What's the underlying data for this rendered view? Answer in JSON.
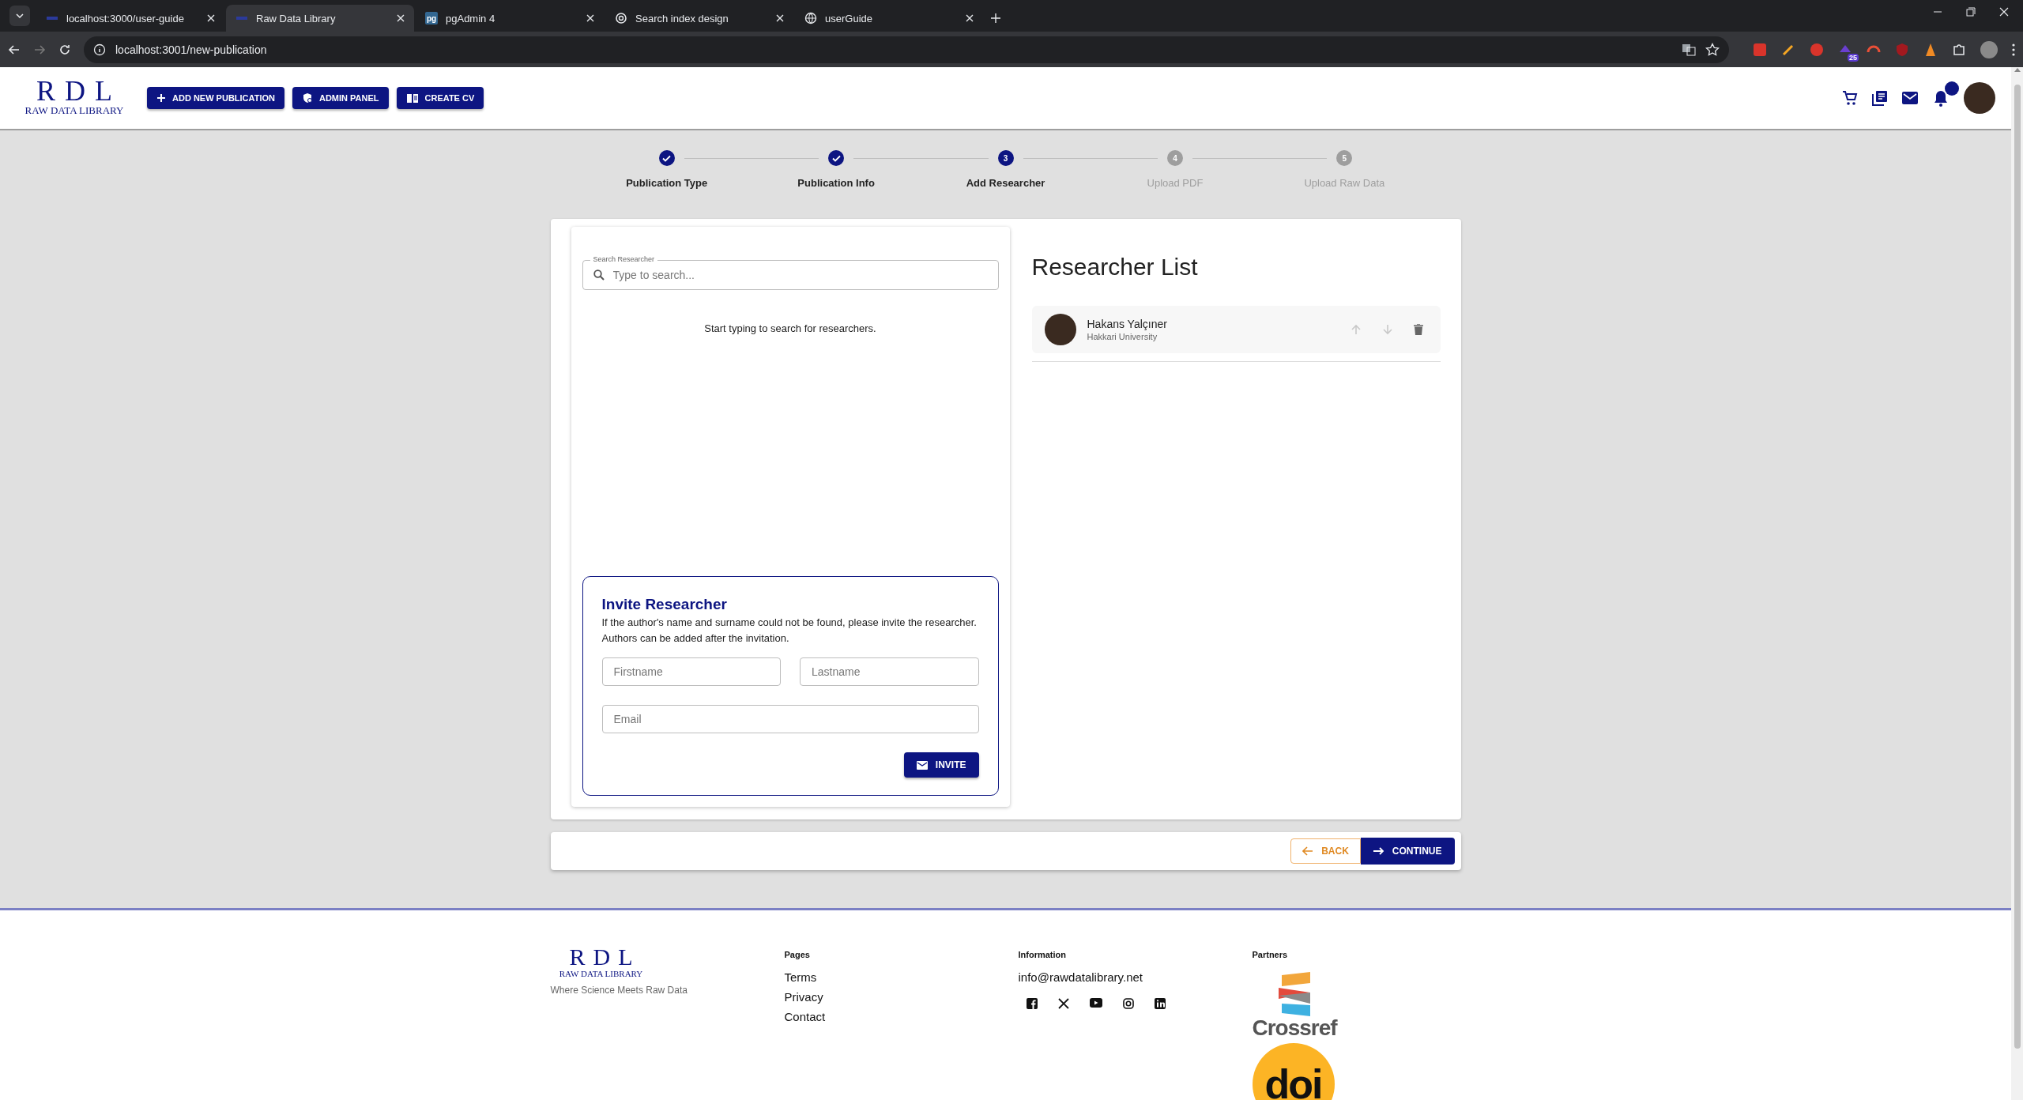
{
  "browser": {
    "tabs": [
      {
        "title": "localhost:3000/user-guide",
        "kind": "rdl",
        "selected": false
      },
      {
        "title": "Raw Data Library",
        "kind": "rdl",
        "selected": true
      },
      {
        "title": "pgAdmin 4",
        "kind": "pg",
        "selected": false
      },
      {
        "title": "Search index design",
        "kind": "knot",
        "selected": false
      },
      {
        "title": "userGuide",
        "kind": "globe",
        "selected": false
      }
    ],
    "pg_icon_text": "pg",
    "address": "localhost:3001/new-publication",
    "extension_badge": "25"
  },
  "header": {
    "logo": {
      "letters": "RDL",
      "caption": "RAW DATA LIBRARY"
    },
    "buttons": [
      {
        "label": "ADD NEW PUBLICATION",
        "kind": "plus"
      },
      {
        "label": "ADMIN PANEL",
        "kind": "shield"
      },
      {
        "label": "CREATE CV",
        "kind": "book"
      }
    ],
    "notification_badge": true
  },
  "stepper": [
    {
      "label": "Publication Type",
      "completed": true,
      "active": false
    },
    {
      "label": "Publication Info",
      "completed": true,
      "active": false
    },
    {
      "label": "Add Researcher",
      "number": "3",
      "completed": false,
      "active": true
    },
    {
      "label": "Upload PDF",
      "number": "4",
      "completed": false,
      "active": false
    },
    {
      "label": "Upload Raw Data",
      "number": "5",
      "completed": false,
      "active": false
    }
  ],
  "search": {
    "label": "Search Researcher",
    "placeholder": "Type to search...",
    "hint": "Start typing to search for researchers."
  },
  "invite": {
    "title": "Invite Researcher",
    "text": "If the author's name and surname could not be found, please invite the researcher. Authors can be added after the invitation.",
    "firstname_placeholder": "Firstname",
    "lastname_placeholder": "Lastname",
    "email_placeholder": "Email",
    "button": "INVITE"
  },
  "researcher_list": {
    "title": "Researcher List",
    "items": [
      {
        "name": "Hakans Yalçıner",
        "affiliation": "Hakkari University",
        "can_move_up": false,
        "can_move_down": false
      }
    ]
  },
  "navigation": {
    "back": "BACK",
    "continue": "CONTINUE"
  },
  "footer": {
    "logo": {
      "letters": "RDL",
      "caption": "RAW DATA LIBRARY"
    },
    "tagline": "Where Science Meets Raw Data",
    "pages_title": "Pages",
    "pages": [
      "Terms",
      "Privacy",
      "Contact"
    ],
    "information_title": "Information",
    "email": "info@rawdatalibrary.net",
    "partners_title": "Partners",
    "partners": [
      {
        "name": "Crossref",
        "kind": "crossref"
      },
      {
        "name": "doi",
        "kind": "doi"
      }
    ]
  }
}
